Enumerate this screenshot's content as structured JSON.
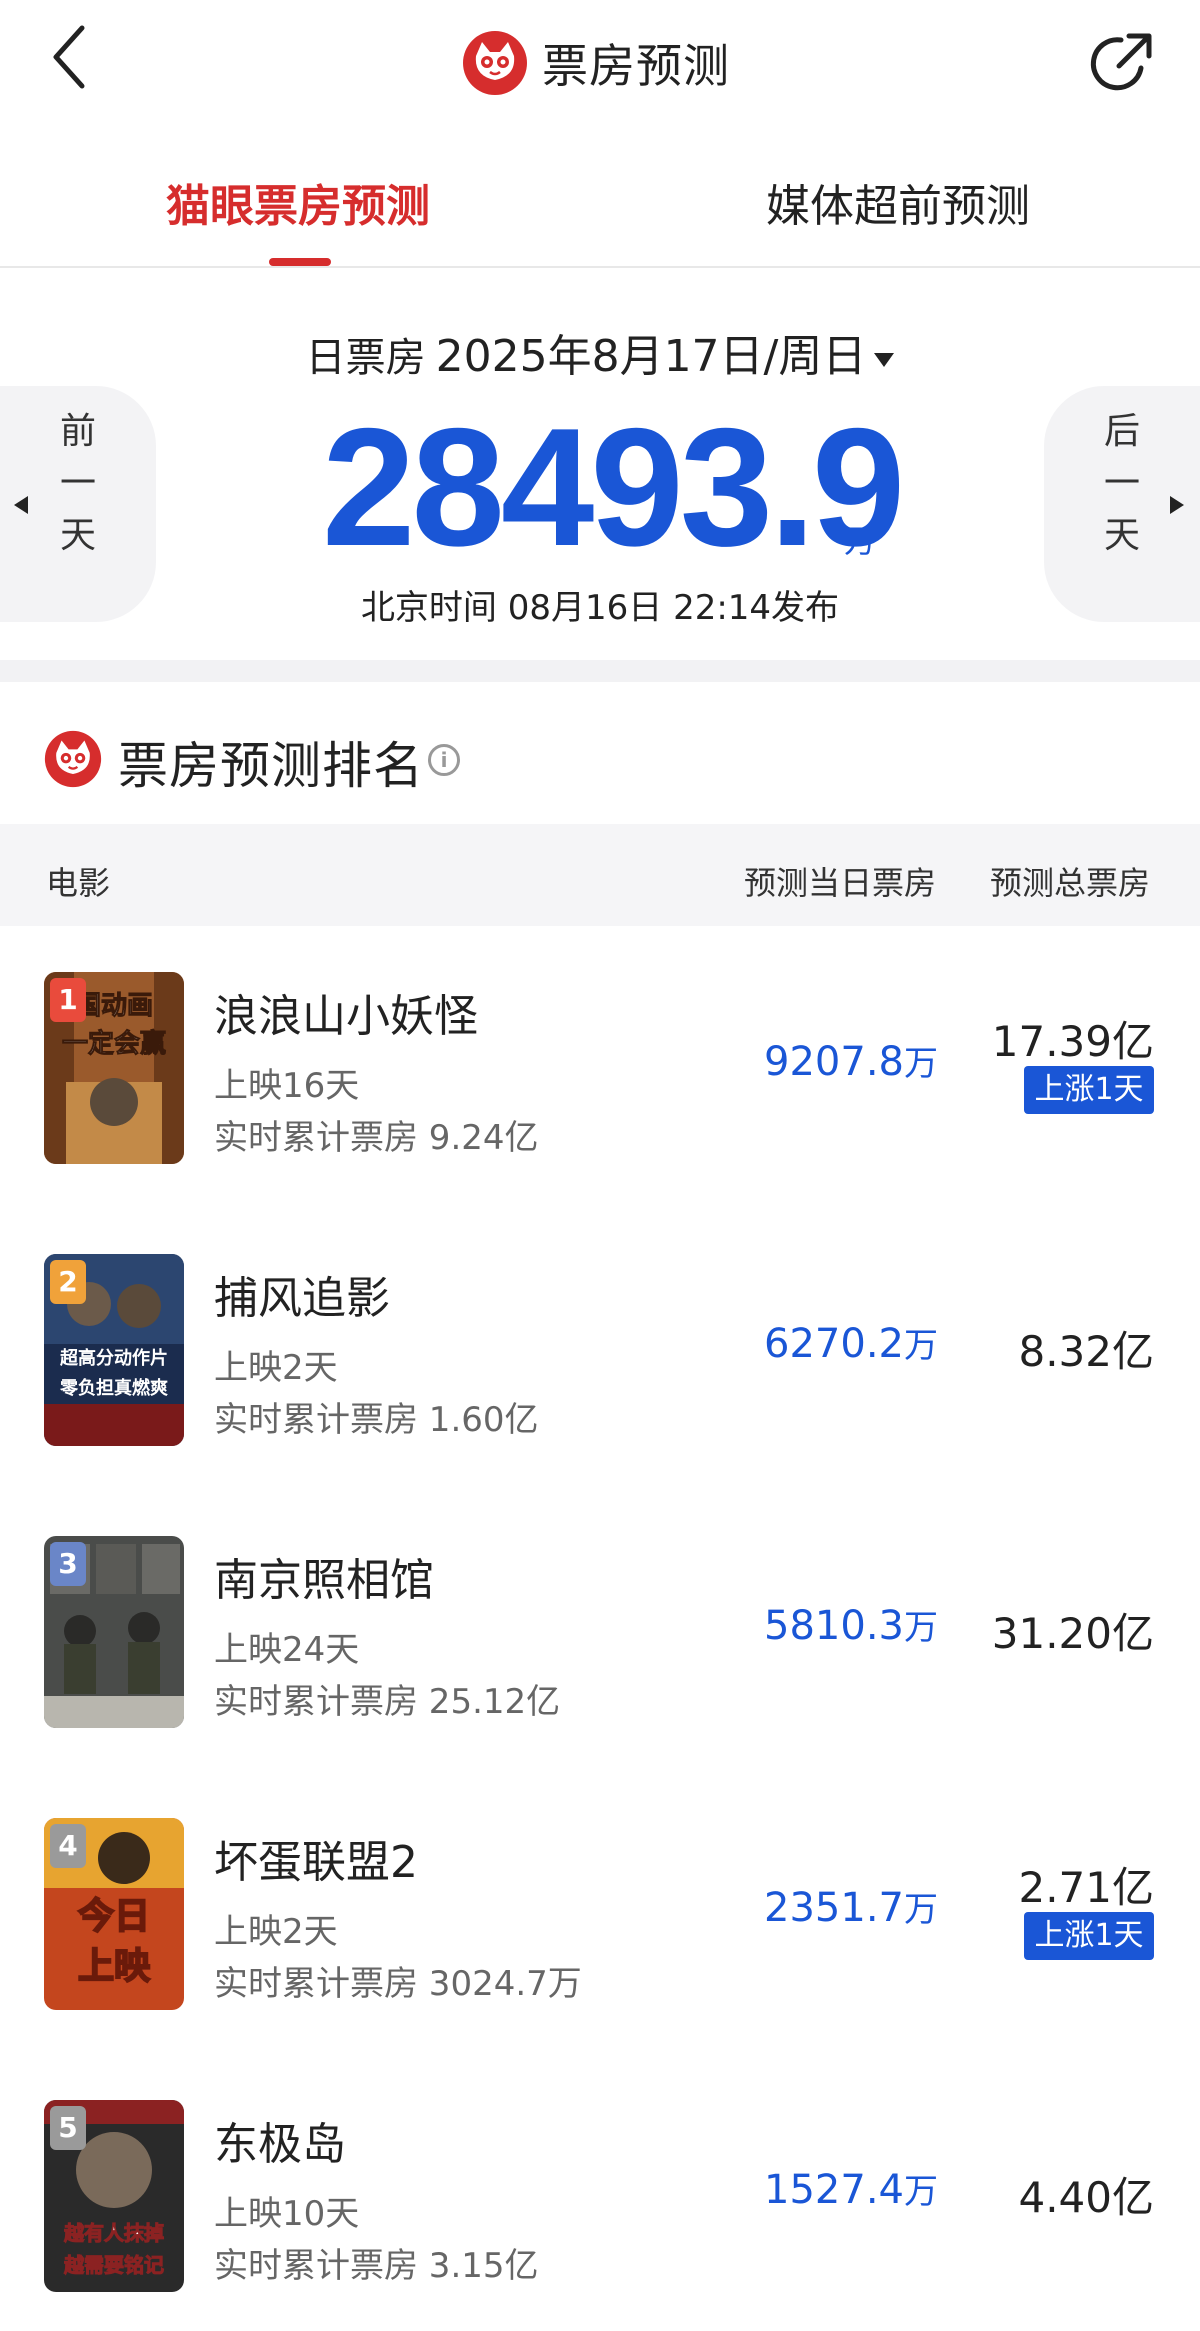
{
  "header": {
    "title": "票房预测",
    "colors": {
      "brand_red": "#d62d2d",
      "accent_blue": "#1a56d6"
    }
  },
  "tabs": [
    {
      "label": "猫眼票房预测",
      "active": true
    },
    {
      "label": "媒体超前预测",
      "active": false
    }
  ],
  "summary": {
    "date_label": "日票房",
    "date_value": "2025年8月17日/周日",
    "prev_label": "前一天",
    "next_label": "后一天",
    "total_value": "28493.9",
    "total_unit": "万",
    "publish_info": "北京时间 08月16日 22:14发布"
  },
  "ranking": {
    "title": "票房预测排名",
    "columns": {
      "movie": "电影",
      "day_pred": "预测当日票房",
      "total_pred": "预测总票房"
    },
    "rows": [
      {
        "rank": "1",
        "name": "浪浪山小妖怪",
        "days": "上映16天",
        "cumulative": "实时累计票房 9.24亿",
        "day_value": "9207.8",
        "day_unit": "万",
        "total": "17.39亿",
        "badge": "上涨1天",
        "badge_color": "#e94b3c",
        "poster_colors": [
          "#9a5a2c",
          "#d79a4e"
        ],
        "poster_text": "中国动画一定会赢"
      },
      {
        "rank": "2",
        "name": "捕风追影",
        "days": "上映2天",
        "cumulative": "实时累计票房 1.60亿",
        "day_value": "6270.2",
        "day_unit": "万",
        "total": "8.32亿",
        "badge": "",
        "badge_color": "#f0a23a",
        "poster_colors": [
          "#1b2c4e",
          "#3a5a86"
        ],
        "poster_text": "超高分动作片 零负担真燃爽"
      },
      {
        "rank": "3",
        "name": "南京照相馆",
        "days": "上映24天",
        "cumulative": "实时累计票房 25.12亿",
        "day_value": "5810.3",
        "day_unit": "万",
        "total": "31.20亿",
        "badge": "",
        "badge_color": "#6a86c8",
        "poster_colors": [
          "#4a4c4a",
          "#9a9a94"
        ],
        "poster_text": ""
      },
      {
        "rank": "4",
        "name": "坏蛋联盟2",
        "days": "上映2天",
        "cumulative": "实时累计票房 3024.7万",
        "day_value": "2351.7",
        "day_unit": "万",
        "total": "2.71亿",
        "badge": "上涨1天",
        "badge_color": "#9a9a9a",
        "poster_colors": [
          "#e7a430",
          "#c4461e"
        ],
        "poster_text": "今日上映"
      },
      {
        "rank": "5",
        "name": "东极岛",
        "days": "上映10天",
        "cumulative": "实时累计票房 3.15亿",
        "day_value": "1527.4",
        "day_unit": "万",
        "total": "4.40亿",
        "badge": "",
        "badge_color": "#9a9a9a",
        "poster_colors": [
          "#2a2a2a",
          "#8b2222"
        ],
        "poster_text": "越有人抹掉 越需要铭记"
      }
    ]
  }
}
